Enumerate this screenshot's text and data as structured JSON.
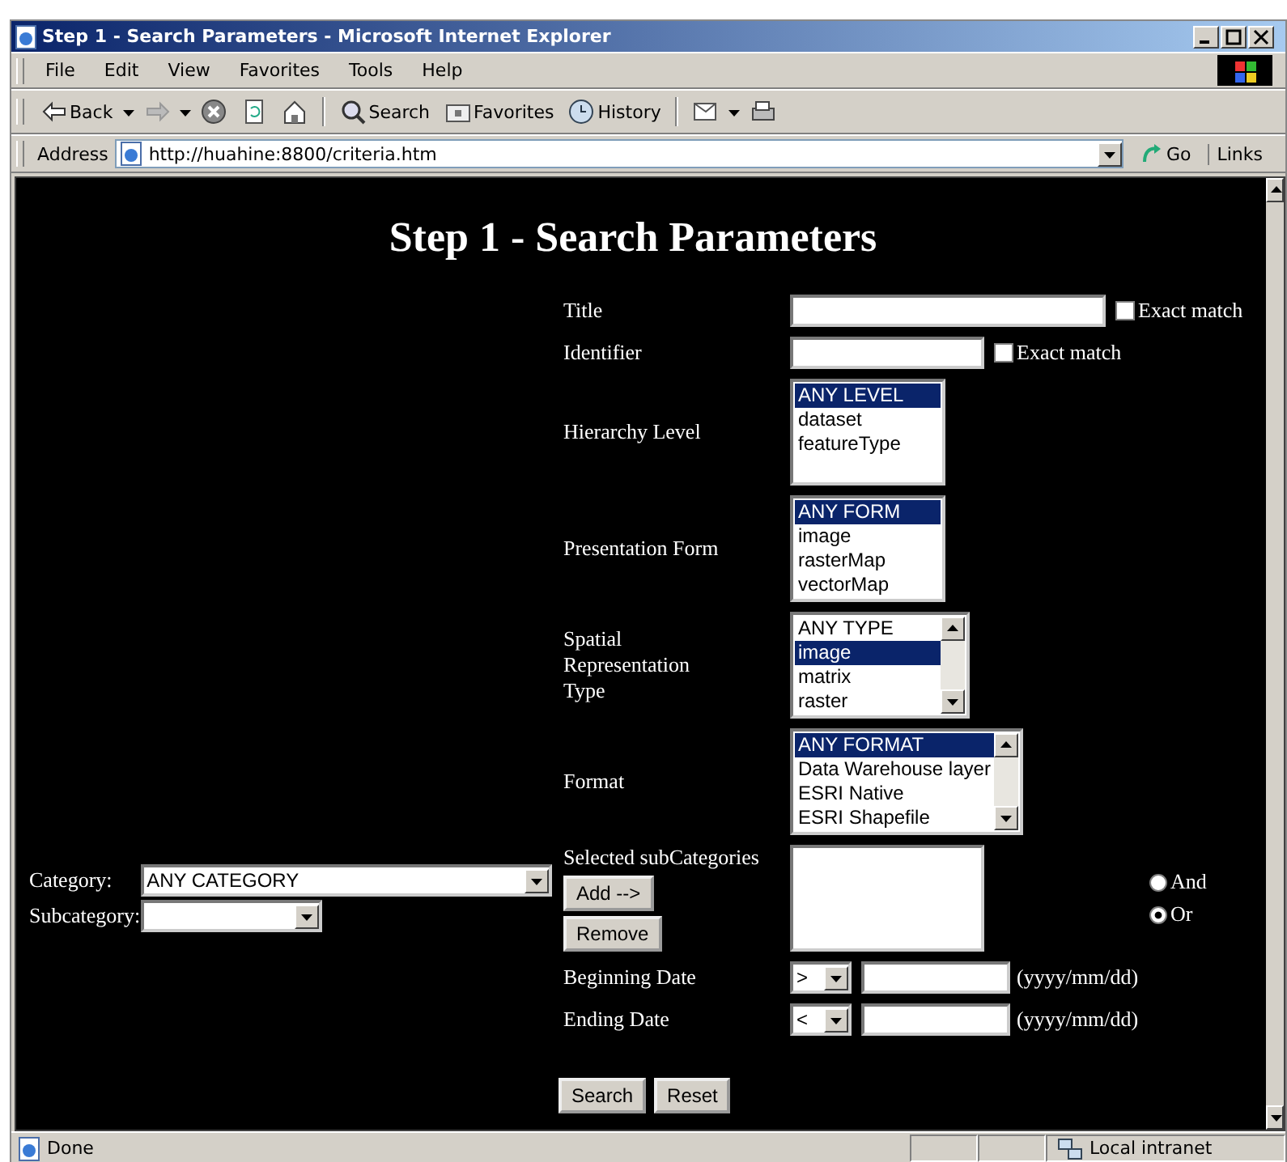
{
  "window": {
    "title": "Step 1 - Search Parameters - Microsoft Internet Explorer"
  },
  "menu": [
    "File",
    "Edit",
    "View",
    "Favorites",
    "Tools",
    "Help"
  ],
  "toolbar": [
    {
      "kind": "back",
      "label": "Back"
    },
    {
      "kind": "forward"
    },
    {
      "kind": "stop"
    },
    {
      "kind": "refresh"
    },
    {
      "kind": "home"
    },
    {
      "kind": "search",
      "label": "Search"
    },
    {
      "kind": "favorites",
      "label": "Favorites"
    },
    {
      "kind": "history",
      "label": "History"
    },
    {
      "kind": "mail"
    },
    {
      "kind": "print"
    }
  ],
  "address": {
    "label": "Address",
    "url": "http://huahine:8800/criteria.htm",
    "go": "Go",
    "links": "Links"
  },
  "heading": "Step 1 - Search Parameters",
  "rows": [
    {
      "kind": "text",
      "label": "Title",
      "exact": {
        "label": "Exact match",
        "checked": false
      }
    },
    {
      "kind": "text",
      "label": "Identifier",
      "exact": {
        "label": "Exact match",
        "checked": false
      }
    },
    {
      "kind": "list",
      "label": "Hierarchy Level",
      "scrollbar": false,
      "options": [
        {
          "text": "ANY LEVEL",
          "selected": true
        },
        {
          "text": "dataset",
          "selected": false
        },
        {
          "text": "featureType",
          "selected": false
        }
      ]
    },
    {
      "kind": "list",
      "label": "Presentation Form",
      "scrollbar": false,
      "options": [
        {
          "text": "ANY FORM",
          "selected": true
        },
        {
          "text": "image",
          "selected": false
        },
        {
          "text": "rasterMap",
          "selected": false
        },
        {
          "text": "vectorMap",
          "selected": false
        }
      ]
    },
    {
      "kind": "list",
      "label": "Spatial Representation Type",
      "scrollbar": true,
      "options": [
        {
          "text": "ANY TYPE",
          "selected": false
        },
        {
          "text": "image",
          "selected": true
        },
        {
          "text": "matrix",
          "selected": false
        },
        {
          "text": "raster",
          "selected": false
        }
      ]
    },
    {
      "kind": "list",
      "label": "Format",
      "scrollbar": true,
      "options": [
        {
          "text": "ANY FORMAT",
          "selected": true
        },
        {
          "text": "Data Warehouse layer",
          "selected": false
        },
        {
          "text": "ESRI Native",
          "selected": false
        },
        {
          "text": "ESRI Shapefile",
          "selected": false
        }
      ]
    }
  ],
  "subcategories": {
    "label": "Selected subCategories",
    "add": "Add -->",
    "remove": "Remove"
  },
  "category": {
    "label": "Category:",
    "value": "ANY CATEGORY"
  },
  "subcategory": {
    "label": "Subcategory:"
  },
  "logic": [
    {
      "label": "And",
      "selected": false
    },
    {
      "label": "Or",
      "selected": true
    }
  ],
  "dates": [
    {
      "label": "Beginning Date",
      "operator": ">",
      "hint": "(yyyy/mm/dd)"
    },
    {
      "label": "Ending Date",
      "operator": "<",
      "hint": "(yyyy/mm/dd)"
    }
  ],
  "buttons": [
    "Search",
    "Reset"
  ],
  "status_bar": {
    "text": "Done",
    "zone": "Local intranet"
  }
}
